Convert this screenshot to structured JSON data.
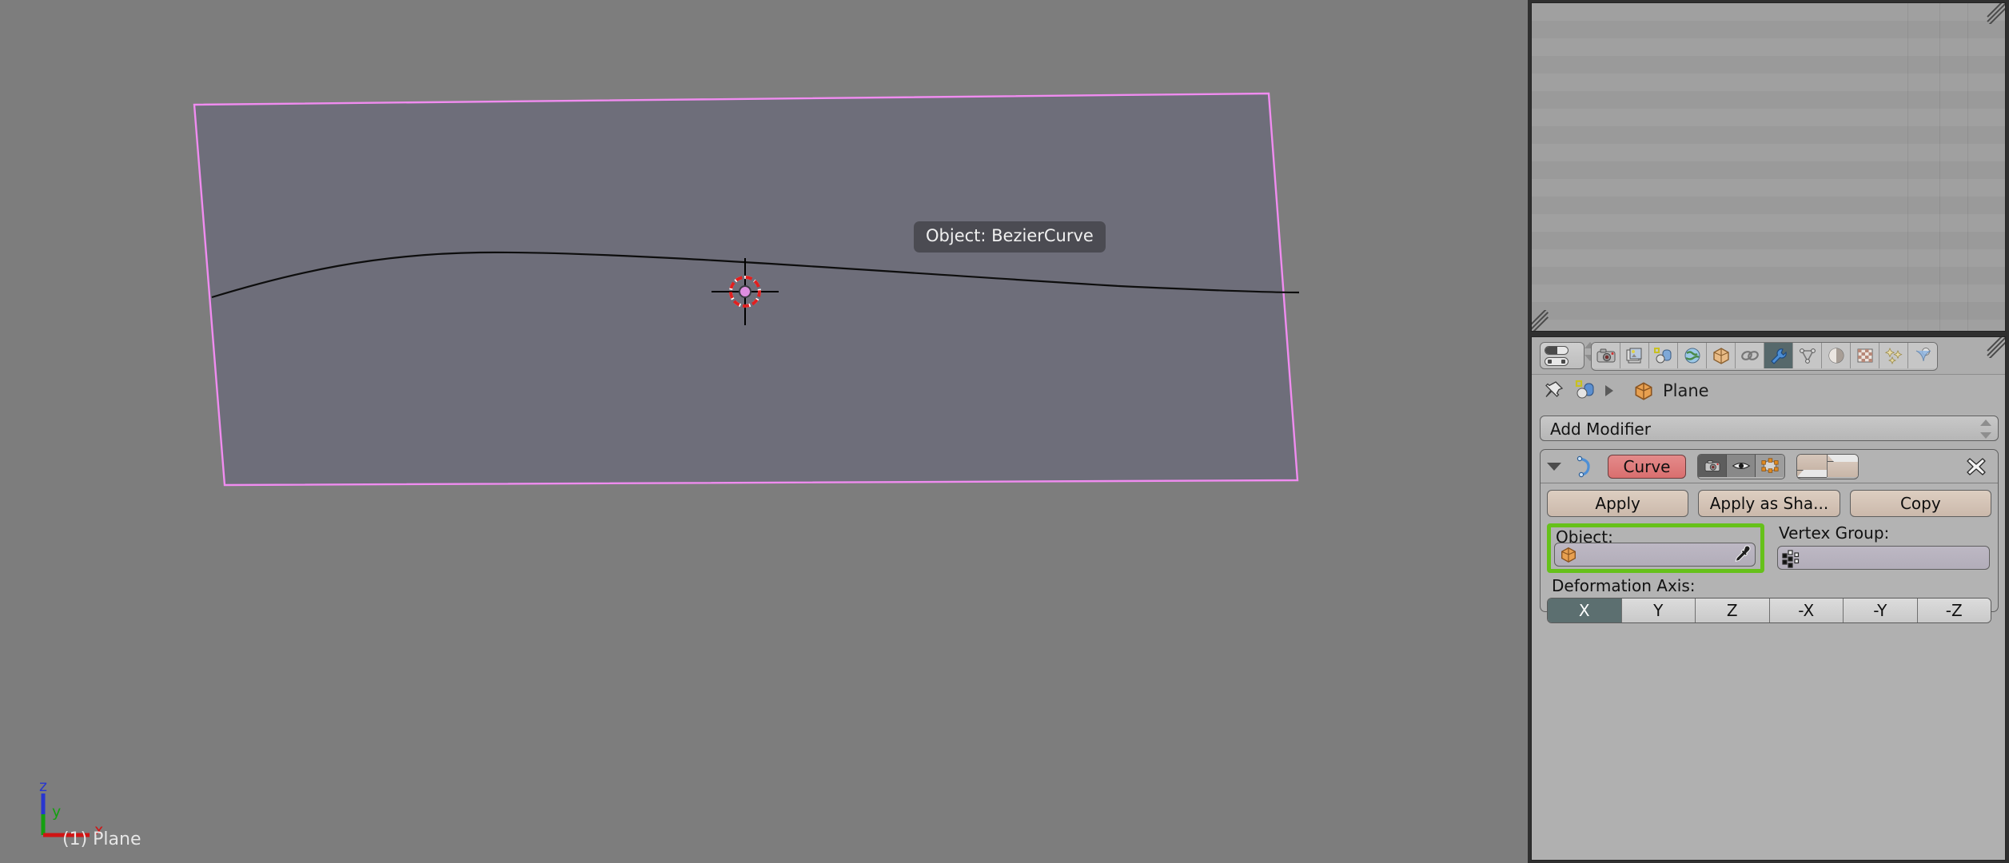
{
  "viewport": {
    "tooltip": "Object: BezierCurve",
    "status_text": "(1) Plane",
    "axis_gizmo": {
      "x": "x",
      "y": "y",
      "z": "z"
    },
    "colors": {
      "background": "#7d7d7d",
      "plane_fill": "#6e6e7a",
      "plane_outline": "#f08cf0",
      "curve_line": "#0a0a0a",
      "cursor_dot": "#dd8ee0"
    },
    "objects": {
      "plane_name": "Plane",
      "curve_name": "BezierCurve"
    }
  },
  "outliner": {
    "empty": true
  },
  "properties": {
    "editor_selector_icon": "editor-type-icon",
    "tabs": [
      {
        "name": "render",
        "icon": "camera-icon",
        "active": false
      },
      {
        "name": "render-layers",
        "icon": "render-layers-icon",
        "active": false
      },
      {
        "name": "scene",
        "icon": "scene-icon",
        "active": false
      },
      {
        "name": "world",
        "icon": "globe-icon",
        "active": false
      },
      {
        "name": "object",
        "icon": "cube-icon",
        "active": false
      },
      {
        "name": "constraints",
        "icon": "chain-icon",
        "active": false
      },
      {
        "name": "modifiers",
        "icon": "wrench-icon",
        "active": true
      },
      {
        "name": "object-data",
        "icon": "mesh-data-icon",
        "active": false
      },
      {
        "name": "material",
        "icon": "material-ball-icon",
        "active": false
      },
      {
        "name": "texture",
        "icon": "checker-icon",
        "active": false
      },
      {
        "name": "particles",
        "icon": "particles-icon",
        "active": false
      },
      {
        "name": "physics",
        "icon": "physics-icon",
        "active": false
      }
    ],
    "breadcrumb": {
      "pin_icon": "pin-icon",
      "scene_icon": "scene-icon",
      "separator": "chevron-right-icon",
      "object_icon": "cube-icon",
      "object_name": "Plane"
    },
    "add_modifier": {
      "label": "Add Modifier",
      "dropdown_icon": "spin-arrows-icon"
    },
    "modifier": {
      "expand_icon": "triangle-down-icon",
      "type_icon": "curve-modifier-icon",
      "name": "Curve",
      "display_toggles": [
        {
          "name": "render",
          "icon": "camera-icon",
          "state": "on"
        },
        {
          "name": "viewport",
          "icon": "eye-icon",
          "state": "off"
        },
        {
          "name": "editmode",
          "icon": "edit-mode-icon",
          "state": "sel"
        }
      ],
      "move_up_icon": "triangle-up-icon",
      "move_down_icon": "triangle-down-icon",
      "delete_icon": "x-close-icon",
      "buttons": [
        {
          "name": "apply",
          "label": "Apply"
        },
        {
          "name": "apply-as-shape",
          "label": "Apply as Sha..."
        },
        {
          "name": "copy",
          "label": "Copy"
        }
      ],
      "object_field": {
        "label": "Object:",
        "value": "",
        "icon": "cube-icon",
        "eyedropper_icon": "eyedropper-icon",
        "highlight_color": "#66c11a"
      },
      "vertex_group_field": {
        "label": "Vertex Group:",
        "value": "",
        "icon": "vertex-group-icon"
      },
      "deformation_axis": {
        "label": "Deformation Axis:",
        "options": [
          "X",
          "Y",
          "Z",
          "-X",
          "-Y",
          "-Z"
        ],
        "selected": "X"
      }
    }
  }
}
